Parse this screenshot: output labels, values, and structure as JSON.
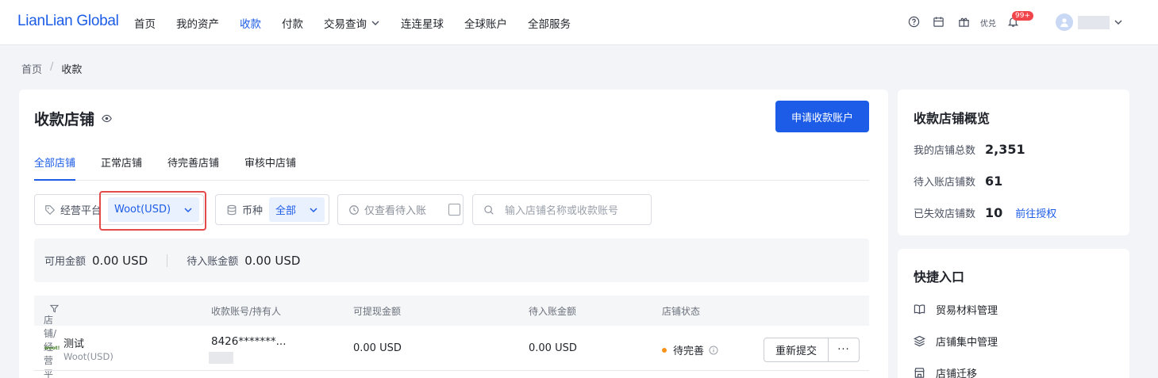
{
  "header": {
    "logo": "LianLian Global",
    "nav": [
      {
        "label": "首页"
      },
      {
        "label": "我的资产"
      },
      {
        "label": "收款",
        "active": true
      },
      {
        "label": "付款"
      },
      {
        "label": "交易查询",
        "dropdown": true
      },
      {
        "label": "连连星球"
      },
      {
        "label": "全球账户"
      },
      {
        "label": "全部服务"
      }
    ],
    "coupon_label": "优兑",
    "notification_count": "99+",
    "icons": [
      "help-icon",
      "calendar-icon",
      "gift-icon",
      "bell-icon",
      "user-avatar-icon",
      "chevron-down-icon"
    ]
  },
  "breadcrumb": {
    "home": "首页",
    "sep": "/",
    "current": "收款"
  },
  "main": {
    "title": "收款店铺",
    "apply_button": "申请收款账户",
    "tabs": [
      {
        "label": "全部店铺",
        "active": true
      },
      {
        "label": "正常店铺"
      },
      {
        "label": "待完善店铺"
      },
      {
        "label": "审核中店铺"
      }
    ],
    "filters": {
      "platform_label": "经营平台",
      "platform_value": "Woot(USD)",
      "currency_label": "币种",
      "currency_value": "全部",
      "pending_only_label": "仅查看待入账",
      "search_placeholder": "输入店铺名称或收款账号"
    },
    "summary": {
      "available_label": "可用金额",
      "available_value": "0.00 USD",
      "pending_label": "待入账金额",
      "pending_value": "0.00 USD"
    },
    "table": {
      "columns": [
        "店铺/经营平台",
        "收款账号/持有人",
        "可提现金额",
        "待入账金额",
        "店铺状态"
      ],
      "rows": [
        {
          "logo_text": "woot!",
          "store_name": "测试",
          "platform": "Woot(USD)",
          "account": "8426*******...",
          "withdrawable": "0.00 USD",
          "pending": "0.00 USD",
          "status": "待完善",
          "status_color": "#f7931a",
          "action": "重新提交",
          "more": "···"
        }
      ]
    }
  },
  "overview": {
    "title": "收款店铺概览",
    "total_label": "我的店铺总数",
    "total_value": "2,351",
    "pending_label": "待入账店铺数",
    "pending_value": "61",
    "expired_label": "已失效店铺数",
    "expired_value": "10",
    "authorize_link": "前往授权"
  },
  "quick_access": {
    "title": "快捷入口",
    "items": [
      {
        "label": "贸易材料管理",
        "icon": "book-icon"
      },
      {
        "label": "店铺集中管理",
        "icon": "layers-icon"
      },
      {
        "label": "店铺迁移",
        "icon": "store-icon"
      }
    ]
  },
  "colors": {
    "accent": "#1d5ce6",
    "highlight": "#e34b4b",
    "status_pending": "#f7931a"
  }
}
